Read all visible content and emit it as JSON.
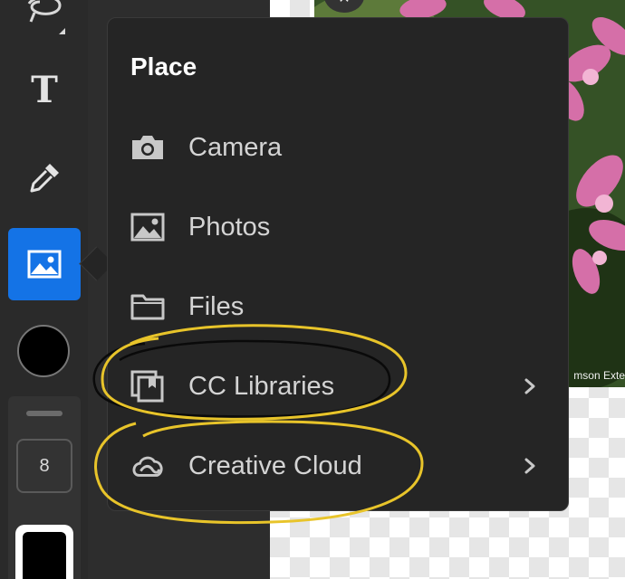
{
  "toolbar": {
    "tools": [
      {
        "name": "lasso-tool",
        "icon": "lasso-icon"
      },
      {
        "name": "text-tool",
        "icon": "text-icon",
        "glyph": "T"
      },
      {
        "name": "eyedropper-tool",
        "icon": "eyedropper-icon"
      },
      {
        "name": "place-image-tool",
        "icon": "image-icon",
        "active": true
      },
      {
        "name": "color-swatch",
        "icon": "color-circle"
      }
    ],
    "brush_size": "8",
    "accent_color": "#1473e6"
  },
  "popover": {
    "title": "Place",
    "items": [
      {
        "label": "Camera",
        "icon": "camera-icon",
        "has_submenu": false
      },
      {
        "label": "Photos",
        "icon": "photos-icon",
        "has_submenu": false
      },
      {
        "label": "Files",
        "icon": "folder-icon",
        "has_submenu": false
      },
      {
        "label": "CC Libraries",
        "icon": "cc-libraries-icon",
        "has_submenu": true
      },
      {
        "label": "Creative Cloud",
        "icon": "creative-cloud-icon",
        "has_submenu": true
      }
    ]
  },
  "canvas": {
    "photo_caption": "mson Exte",
    "close_glyph": "✕"
  },
  "colors": {
    "background": "#2d2d2d",
    "popover": "#252525",
    "annotation_yellow": "#e8c42a",
    "annotation_black": "#0a0a0a"
  }
}
